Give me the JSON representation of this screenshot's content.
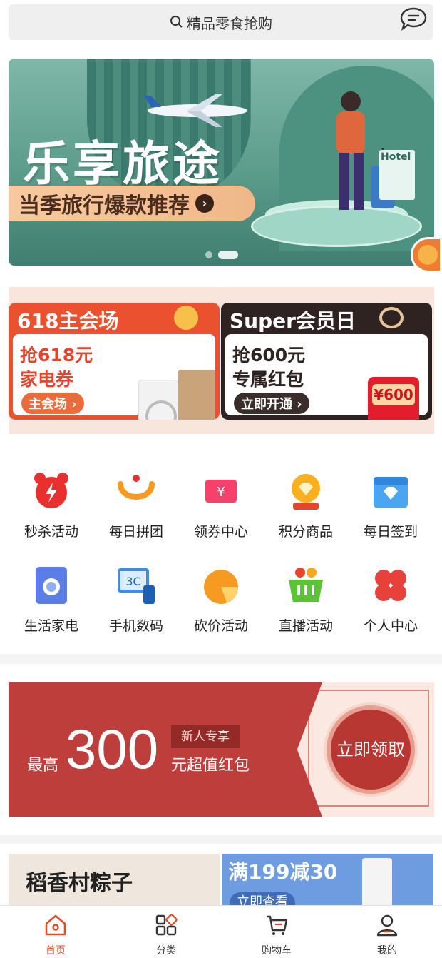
{
  "header": {
    "search_placeholder": "精品零食抢购",
    "message_icon": "chat-bubble-icon"
  },
  "banner": {
    "title": "乐享旅途",
    "subtitle": "当季旅行爆款推荐",
    "hotel_sign": "Hotel",
    "active_slide": 2,
    "slide_count": 2
  },
  "promos": {
    "left": {
      "title": "618主会场",
      "line1": "抢618元",
      "line2": "家电券",
      "button": "主会场 ›"
    },
    "right": {
      "title": "Super会员日",
      "line1": "抢600元",
      "line2": "专属红包",
      "button": "立即开通 ›",
      "amount": "¥600"
    }
  },
  "grid": [
    {
      "label": "秒杀活动",
      "icon": "alarm-clock-icon"
    },
    {
      "label": "每日拼团",
      "icon": "smile-icon"
    },
    {
      "label": "领券中心",
      "icon": "coupon-ticket-icon"
    },
    {
      "label": "积分商品",
      "icon": "gem-medal-icon"
    },
    {
      "label": "每日签到",
      "icon": "calendar-diamond-icon"
    },
    {
      "label": "生活家电",
      "icon": "washing-machine-icon"
    },
    {
      "label": "手机数码",
      "icon": "3c-devices-icon"
    },
    {
      "label": "砍价活动",
      "icon": "orange-icon"
    },
    {
      "label": "直播活动",
      "icon": "basket-icon"
    },
    {
      "label": "个人中心",
      "icon": "clover-icon"
    }
  ],
  "coupon": {
    "prefix": "最高",
    "amount": "300",
    "tag": "新人专享",
    "desc": "元超值红包",
    "button": "立即领取"
  },
  "strip": {
    "left": "稻香村粽子",
    "right_title": "满199减30",
    "right_button": "立即查看"
  },
  "tabbar": [
    {
      "label": "首页",
      "icon": "home-icon",
      "active": true
    },
    {
      "label": "分类",
      "icon": "category-icon",
      "active": false
    },
    {
      "label": "购物车",
      "icon": "cart-icon",
      "active": false
    },
    {
      "label": "我的",
      "icon": "user-icon",
      "active": false
    }
  ],
  "colors": {
    "accent": "#e14d2a",
    "coupon_red": "#bd3e3b",
    "banner_green": "#5c9c8b"
  }
}
